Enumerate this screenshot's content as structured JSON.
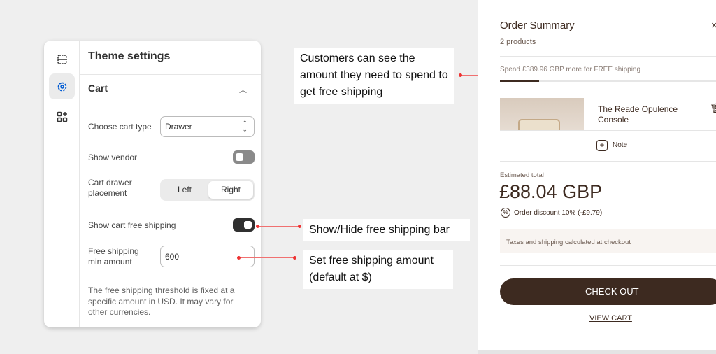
{
  "settings": {
    "title": "Theme settings",
    "rail_icons": [
      "sections-icon",
      "settings-gear-icon",
      "apps-add-icon"
    ],
    "section": "Cart",
    "cart_type_label": "Choose cart type",
    "cart_type_value": "Drawer",
    "show_vendor_label": "Show vendor",
    "show_vendor_on": false,
    "placement_label": "Cart drawer placement",
    "placement_options": [
      "Left",
      "Right"
    ],
    "placement_selected": "Right",
    "free_shipping_label": "Show cart free shipping",
    "free_shipping_on": true,
    "min_amount_label": "Free shipping min amount",
    "min_amount_value": "600",
    "help_text": "The free shipping threshold is fixed at a specific amount in USD. It may vary for other currencies.",
    "accent": "#005bd3"
  },
  "callouts": {
    "progress": "Customers can see the amount they need to spend to get free shipping",
    "toggle": "Show/Hide free shipping bar",
    "amount": "Set free shipping amount (default at $)"
  },
  "drawer": {
    "title": "Order Summary",
    "count": "2 products",
    "shipping_msg": "Spend £389.96 GBP more for FREE shipping",
    "shipping_progress": 0.18,
    "product_name": "The Reade Opulence Console",
    "note": "Note",
    "estimated_label": "Estimated total",
    "total": "£88.04 GBP",
    "discount": "Order discount 10% (-£9.79)",
    "taxes": "Taxes and shipping calculated at checkout",
    "checkout": "CHECK OUT",
    "view_cart": "VIEW CART",
    "brand_color": "#3d2a20"
  }
}
